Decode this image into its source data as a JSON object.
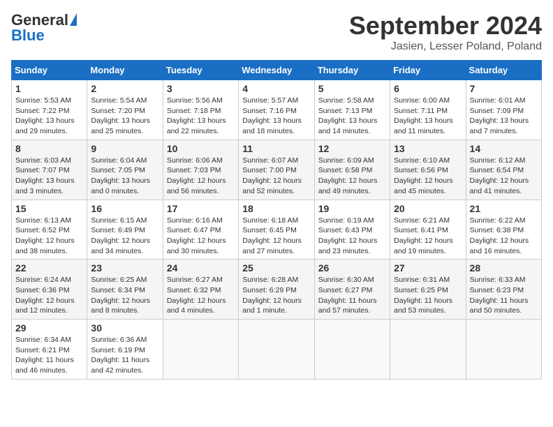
{
  "header": {
    "logo_general": "General",
    "logo_blue": "Blue",
    "month_title": "September 2024",
    "location": "Jasien, Lesser Poland, Poland"
  },
  "weekdays": [
    "Sunday",
    "Monday",
    "Tuesday",
    "Wednesday",
    "Thursday",
    "Friday",
    "Saturday"
  ],
  "weeks": [
    [
      {
        "day": "1",
        "info": "Sunrise: 5:53 AM\nSunset: 7:22 PM\nDaylight: 13 hours\nand 29 minutes."
      },
      {
        "day": "2",
        "info": "Sunrise: 5:54 AM\nSunset: 7:20 PM\nDaylight: 13 hours\nand 25 minutes."
      },
      {
        "day": "3",
        "info": "Sunrise: 5:56 AM\nSunset: 7:18 PM\nDaylight: 13 hours\nand 22 minutes."
      },
      {
        "day": "4",
        "info": "Sunrise: 5:57 AM\nSunset: 7:16 PM\nDaylight: 13 hours\nand 18 minutes."
      },
      {
        "day": "5",
        "info": "Sunrise: 5:58 AM\nSunset: 7:13 PM\nDaylight: 13 hours\nand 14 minutes."
      },
      {
        "day": "6",
        "info": "Sunrise: 6:00 AM\nSunset: 7:11 PM\nDaylight: 13 hours\nand 11 minutes."
      },
      {
        "day": "7",
        "info": "Sunrise: 6:01 AM\nSunset: 7:09 PM\nDaylight: 13 hours\nand 7 minutes."
      }
    ],
    [
      {
        "day": "8",
        "info": "Sunrise: 6:03 AM\nSunset: 7:07 PM\nDaylight: 13 hours\nand 3 minutes."
      },
      {
        "day": "9",
        "info": "Sunrise: 6:04 AM\nSunset: 7:05 PM\nDaylight: 13 hours\nand 0 minutes."
      },
      {
        "day": "10",
        "info": "Sunrise: 6:06 AM\nSunset: 7:03 PM\nDaylight: 12 hours\nand 56 minutes."
      },
      {
        "day": "11",
        "info": "Sunrise: 6:07 AM\nSunset: 7:00 PM\nDaylight: 12 hours\nand 52 minutes."
      },
      {
        "day": "12",
        "info": "Sunrise: 6:09 AM\nSunset: 6:58 PM\nDaylight: 12 hours\nand 49 minutes."
      },
      {
        "day": "13",
        "info": "Sunrise: 6:10 AM\nSunset: 6:56 PM\nDaylight: 12 hours\nand 45 minutes."
      },
      {
        "day": "14",
        "info": "Sunrise: 6:12 AM\nSunset: 6:54 PM\nDaylight: 12 hours\nand 41 minutes."
      }
    ],
    [
      {
        "day": "15",
        "info": "Sunrise: 6:13 AM\nSunset: 6:52 PM\nDaylight: 12 hours\nand 38 minutes."
      },
      {
        "day": "16",
        "info": "Sunrise: 6:15 AM\nSunset: 6:49 PM\nDaylight: 12 hours\nand 34 minutes."
      },
      {
        "day": "17",
        "info": "Sunrise: 6:16 AM\nSunset: 6:47 PM\nDaylight: 12 hours\nand 30 minutes."
      },
      {
        "day": "18",
        "info": "Sunrise: 6:18 AM\nSunset: 6:45 PM\nDaylight: 12 hours\nand 27 minutes."
      },
      {
        "day": "19",
        "info": "Sunrise: 6:19 AM\nSunset: 6:43 PM\nDaylight: 12 hours\nand 23 minutes."
      },
      {
        "day": "20",
        "info": "Sunrise: 6:21 AM\nSunset: 6:41 PM\nDaylight: 12 hours\nand 19 minutes."
      },
      {
        "day": "21",
        "info": "Sunrise: 6:22 AM\nSunset: 6:38 PM\nDaylight: 12 hours\nand 16 minutes."
      }
    ],
    [
      {
        "day": "22",
        "info": "Sunrise: 6:24 AM\nSunset: 6:36 PM\nDaylight: 12 hours\nand 12 minutes."
      },
      {
        "day": "23",
        "info": "Sunrise: 6:25 AM\nSunset: 6:34 PM\nDaylight: 12 hours\nand 8 minutes."
      },
      {
        "day": "24",
        "info": "Sunrise: 6:27 AM\nSunset: 6:32 PM\nDaylight: 12 hours\nand 4 minutes."
      },
      {
        "day": "25",
        "info": "Sunrise: 6:28 AM\nSunset: 6:29 PM\nDaylight: 12 hours\nand 1 minute."
      },
      {
        "day": "26",
        "info": "Sunrise: 6:30 AM\nSunset: 6:27 PM\nDaylight: 11 hours\nand 57 minutes."
      },
      {
        "day": "27",
        "info": "Sunrise: 6:31 AM\nSunset: 6:25 PM\nDaylight: 11 hours\nand 53 minutes."
      },
      {
        "day": "28",
        "info": "Sunrise: 6:33 AM\nSunset: 6:23 PM\nDaylight: 11 hours\nand 50 minutes."
      }
    ],
    [
      {
        "day": "29",
        "info": "Sunrise: 6:34 AM\nSunset: 6:21 PM\nDaylight: 11 hours\nand 46 minutes."
      },
      {
        "day": "30",
        "info": "Sunrise: 6:36 AM\nSunset: 6:19 PM\nDaylight: 11 hours\nand 42 minutes."
      },
      {
        "day": "",
        "info": ""
      },
      {
        "day": "",
        "info": ""
      },
      {
        "day": "",
        "info": ""
      },
      {
        "day": "",
        "info": ""
      },
      {
        "day": "",
        "info": ""
      }
    ]
  ]
}
